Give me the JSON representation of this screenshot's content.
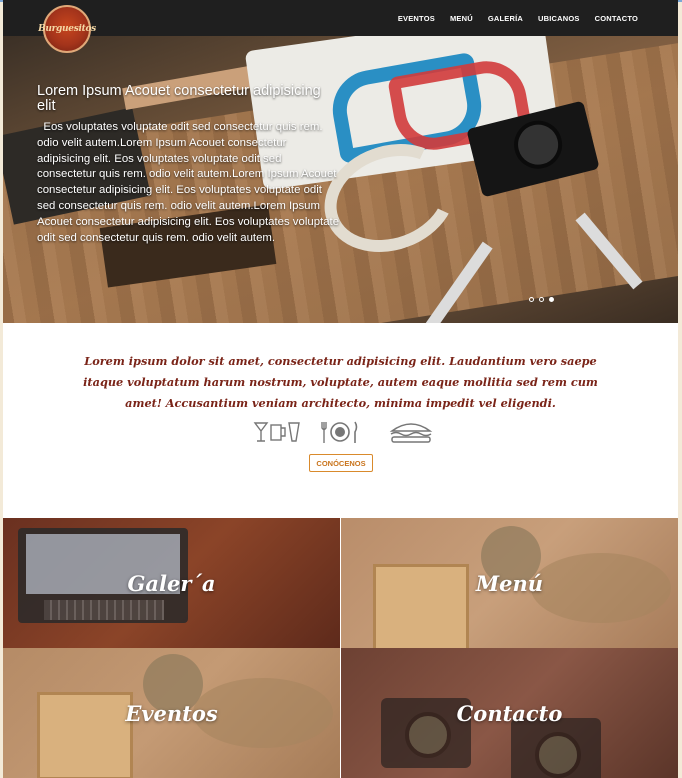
{
  "brand": {
    "logo_text": "Burguesitos"
  },
  "nav": {
    "items": [
      {
        "label": "EVENTOS"
      },
      {
        "label": "MENÚ"
      },
      {
        "label": "GALERÍA"
      },
      {
        "label": "UBICANOS"
      },
      {
        "label": "CONTACTO"
      }
    ]
  },
  "hero": {
    "title": "Lorem Ipsum Acouet consectetur adipisicing elit",
    "body": "  Eos voluptates voluptate odit sed consectetur quis rem. odio velit autem.Lorem Ipsum Acouet consectetur adipisicing elit. Eos voluptates voluptate odit sed consectetur quis rem. odio velit autem.Lorem Ipsum Acouet consectetur adipisicing elit. Eos voluptates voluptate odit sed consectetur quis rem. odio velit autem.Lorem Ipsum Acouet consectetur adipisicing elit. Eos voluptates voluptate odit sed consectetur quis rem. odio velit autem.",
    "slides": 3,
    "active_slide": 3
  },
  "intro": {
    "tagline": "Lorem ipsum dolor sit amet, consectetur adipisicing elit. Laudantium vero saepe itaque voluptatum harum nostrum, voluptate, autem eaque mollitia sed rem cum amet! Accusantium veniam architecto, minima impedit vel eligendi.",
    "icons": [
      "drinks-icon",
      "dinner-plate-icon",
      "burger-icon"
    ],
    "button_label": "CONÓCENOS"
  },
  "tiles": [
    {
      "label": "Galer´a"
    },
    {
      "label": "Menú"
    },
    {
      "label": "Eventos"
    },
    {
      "label": "Contacto"
    }
  ],
  "colors": {
    "navbar": "#1f1f1f",
    "tagline": "#7a2418",
    "button_border": "#d98a2c",
    "page_background": "#f3ead8"
  }
}
